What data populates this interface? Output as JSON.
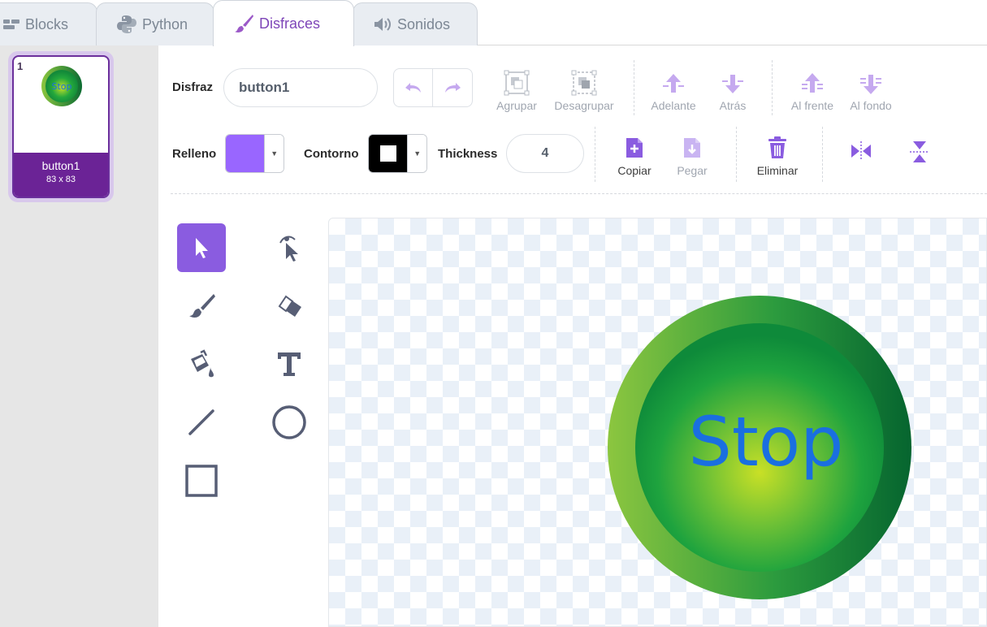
{
  "tabs": [
    {
      "label": "Blocks",
      "icon": "blocks-icon"
    },
    {
      "label": "Python",
      "icon": "python-icon"
    },
    {
      "label": "Disfraces",
      "icon": "brush-icon"
    },
    {
      "label": "Sonidos",
      "icon": "speaker-icon"
    }
  ],
  "costumes": [
    {
      "number": "1",
      "name": "button1",
      "size": "83 x 83",
      "thumb_text": "Stop"
    }
  ],
  "toolbar": {
    "costume_label": "Disfraz",
    "costume_name": "button1",
    "group": "Agrupar",
    "ungroup": "Desagrupar",
    "forward": "Adelante",
    "backward": "Atrás",
    "front": "Al frente",
    "back": "Al fondo",
    "fill_label": "Relleno",
    "fill_color": "#9966ff",
    "outline_label": "Contorno",
    "outline_color": "#000000",
    "thickness_label": "Thickness",
    "thickness_value": "4",
    "copy": "Copiar",
    "paste": "Pegar",
    "delete": "Eliminar"
  },
  "tools": [
    {
      "name": "select",
      "icon": "select-arrow-icon",
      "selected": true
    },
    {
      "name": "reshape",
      "icon": "reshape-icon"
    },
    {
      "name": "brush",
      "icon": "brush-icon"
    },
    {
      "name": "eraser",
      "icon": "eraser-icon"
    },
    {
      "name": "fill",
      "icon": "fill-bucket-icon"
    },
    {
      "name": "text",
      "icon": "text-icon"
    },
    {
      "name": "line",
      "icon": "line-icon"
    },
    {
      "name": "circle",
      "icon": "circle-icon"
    },
    {
      "name": "rectangle",
      "icon": "rectangle-icon"
    }
  ],
  "canvas": {
    "button_text": "Stop",
    "text_color": "#1a6fe0"
  },
  "colors": {
    "accent": "#855cd6",
    "costume_selected": "#6b2396"
  }
}
